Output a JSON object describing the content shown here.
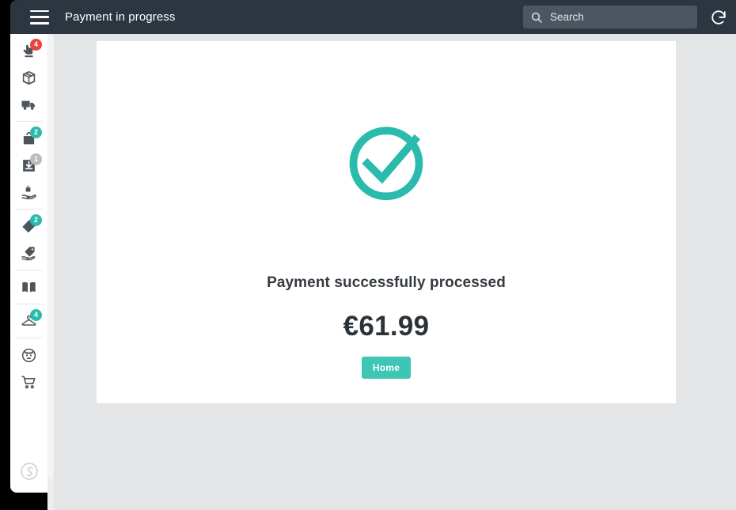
{
  "header": {
    "menu_icon": "hamburger-menu-icon",
    "title": "Payment in progress",
    "search": {
      "icon": "search-icon",
      "placeholder": "Search",
      "value": ""
    },
    "refresh_icon": "refresh-icon"
  },
  "sidebar": {
    "groups": [
      {
        "items": [
          {
            "icon": "hand-pointer-icon",
            "badge": "4",
            "badge_color": "#e8453c"
          },
          {
            "icon": "package-box-icon",
            "badge": "",
            "badge_color": ""
          },
          {
            "icon": "delivery-truck-icon",
            "badge": "",
            "badge_color": ""
          }
        ]
      },
      {
        "items": [
          {
            "icon": "shopping-bag-icon",
            "badge": "2",
            "badge_color": "#2bbbad"
          },
          {
            "icon": "inbox-download-icon",
            "badge": "1",
            "badge_color": "#b9bcbe"
          },
          {
            "icon": "hand-holding-bag-icon",
            "badge": "",
            "badge_color": ""
          }
        ]
      },
      {
        "items": [
          {
            "icon": "price-tags-icon",
            "badge": "2",
            "badge_color": "#2bbbad"
          },
          {
            "icon": "hand-holding-tag-icon",
            "badge": "",
            "badge_color": ""
          }
        ]
      },
      {
        "items": [
          {
            "icon": "open-book-catalog-icon",
            "badge": "",
            "badge_color": ""
          }
        ]
      },
      {
        "items": [
          {
            "icon": "clothes-hanger-icon",
            "badge": "4",
            "badge_color": "#2bbbad"
          }
        ]
      },
      {
        "items": [
          {
            "icon": "customer-face-icon",
            "badge": "",
            "badge_color": ""
          },
          {
            "icon": "shopping-cart-icon",
            "badge": "",
            "badge_color": ""
          }
        ]
      }
    ],
    "brand_logo_icon": "brand-logo-icon"
  },
  "main": {
    "status_icon": "check-circle-icon",
    "status_color": "#2bbbad",
    "success_message": "Payment successfully processed",
    "amount": "€61.99",
    "home_button_label": "Home",
    "home_button_color": "#3ec5b4"
  }
}
